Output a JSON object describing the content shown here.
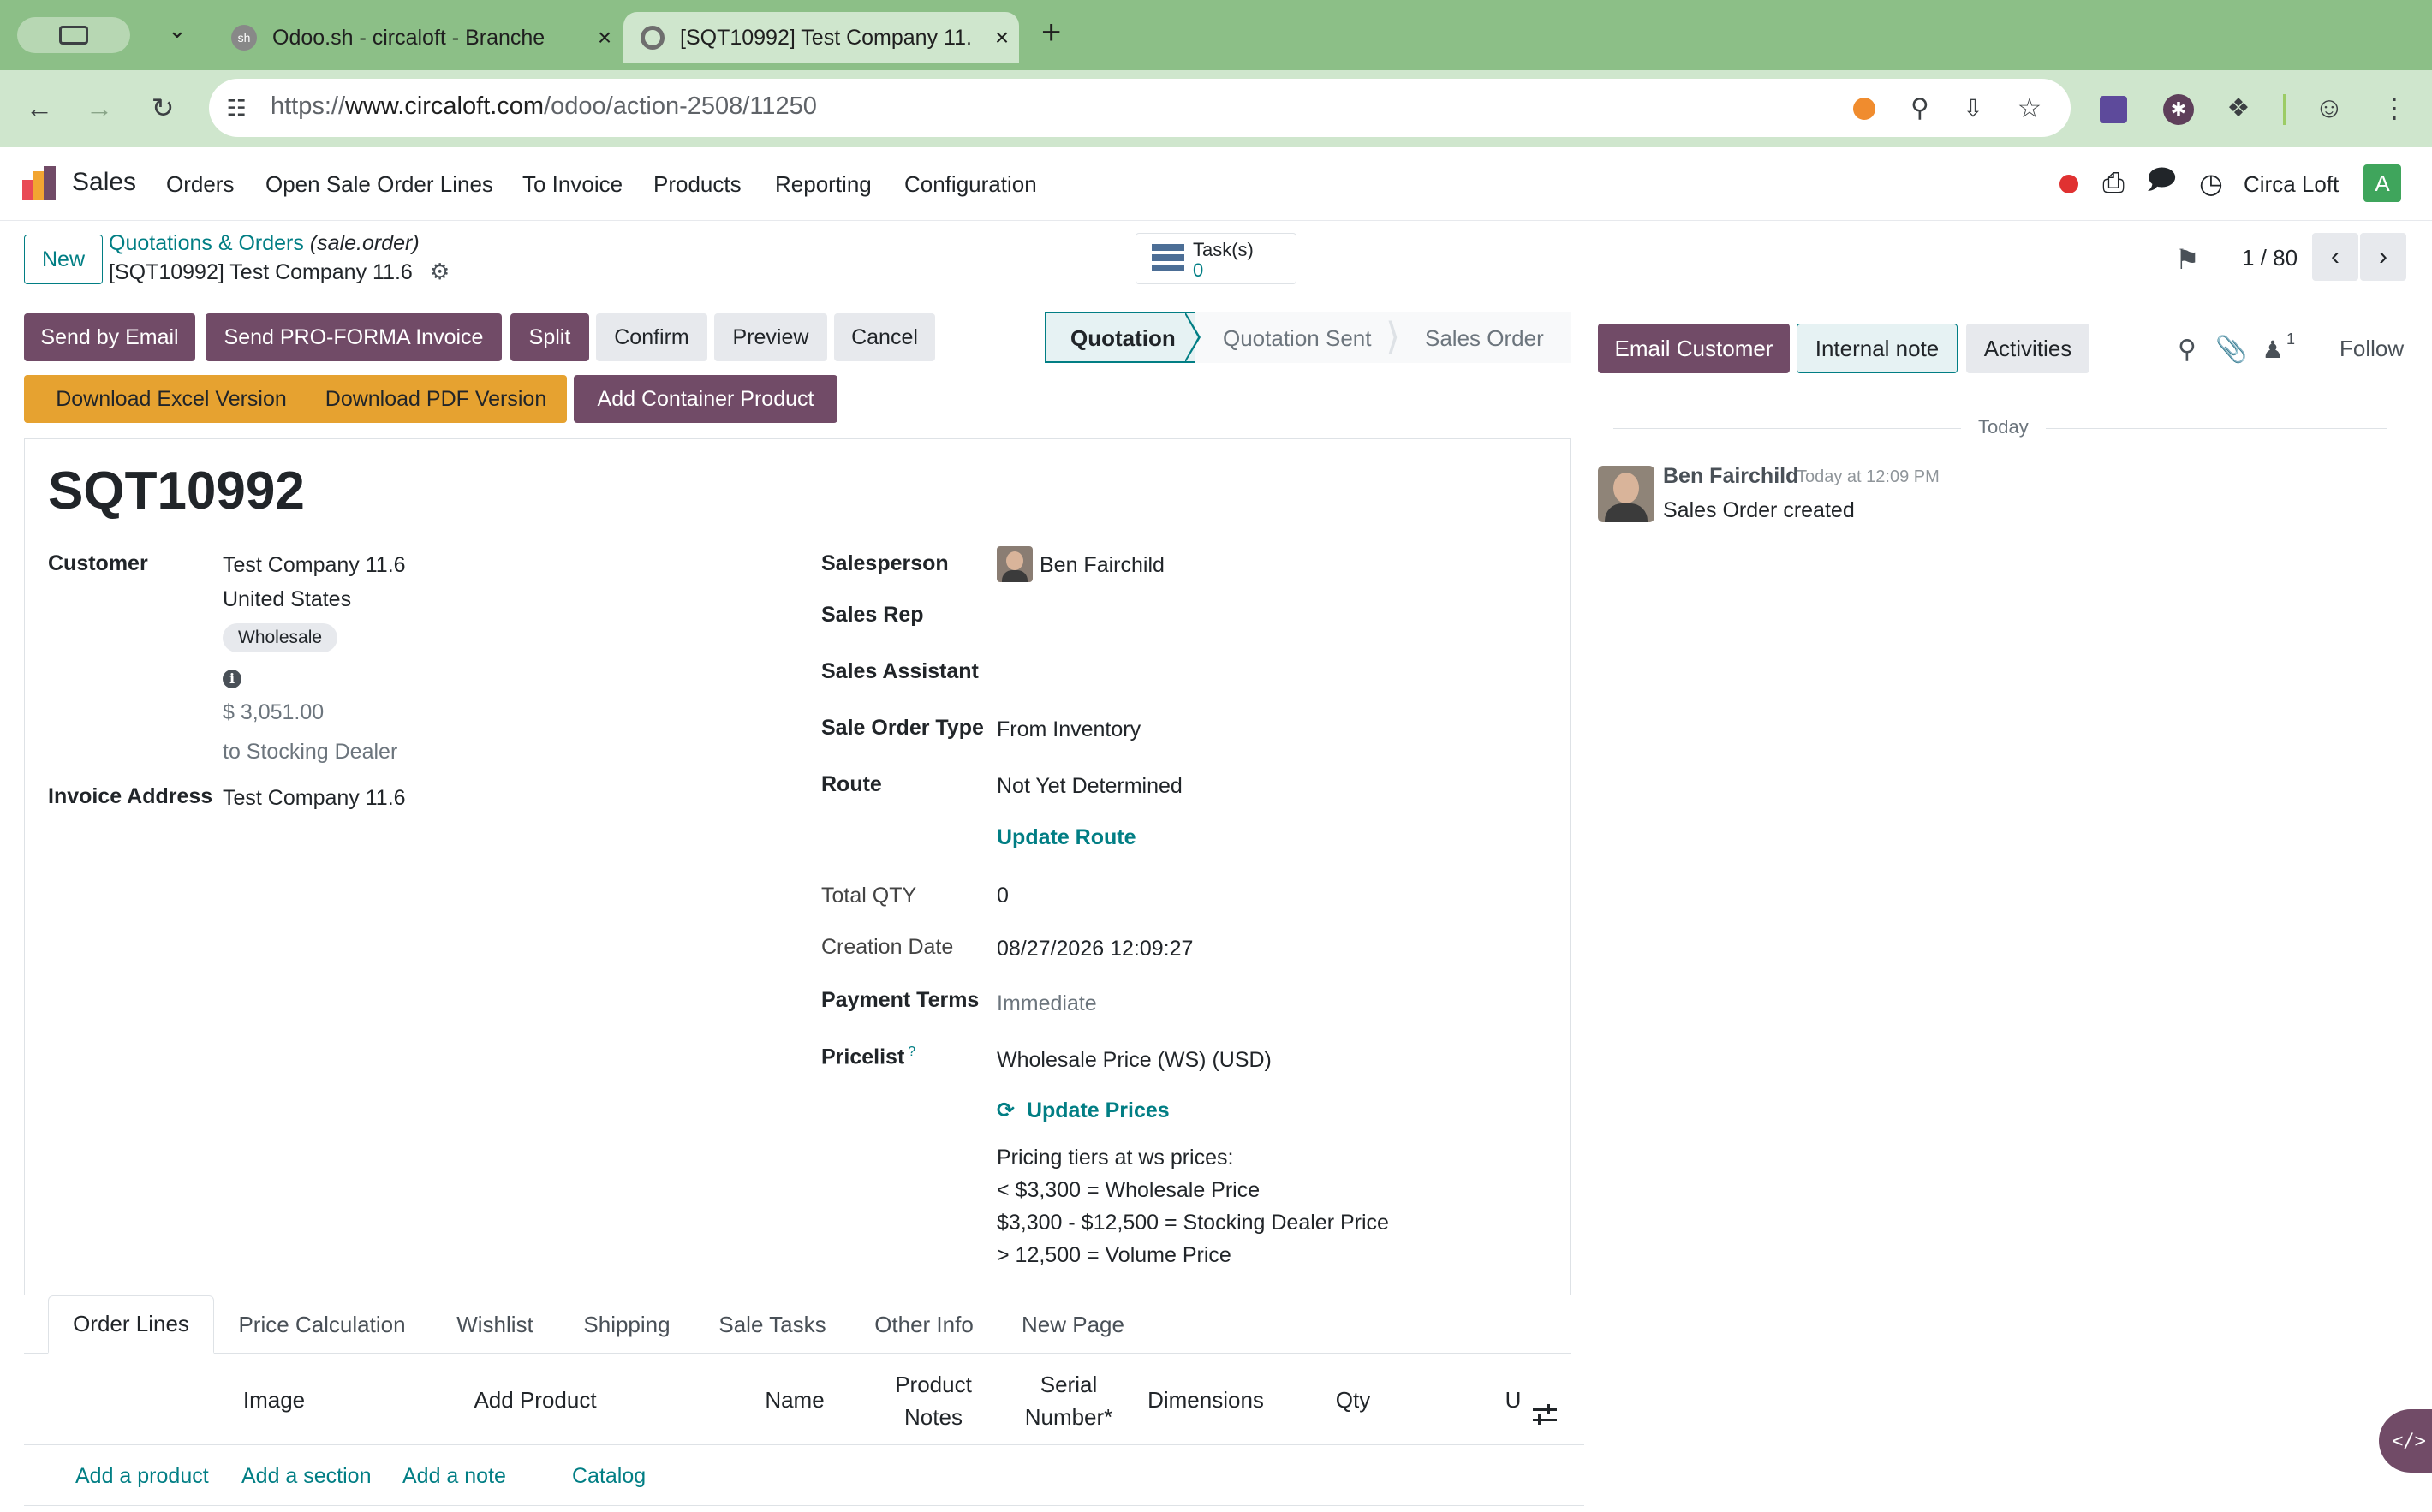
{
  "browser": {
    "tabs": [
      {
        "title": "Odoo.sh - circaloft - Branche",
        "active": false
      },
      {
        "title": "[SQT10992] Test Company 11.",
        "active": true
      }
    ],
    "favicon_text": "sh",
    "new_tab_symbol": "+",
    "url_prefix": "https://",
    "url_host": "www.circaloft.com",
    "url_path": "/odoo/action-2508/11250"
  },
  "app": {
    "name": "Sales",
    "menu": [
      "Orders",
      "Open Sale Order Lines",
      "To Invoice",
      "Products",
      "Reporting",
      "Configuration"
    ],
    "company": "Circa Loft",
    "user_initial": "A"
  },
  "control_panel": {
    "new_label": "New",
    "breadcrumb_parent": "Quotations & Orders",
    "breadcrumb_model": "(sale.order)",
    "record_name": "[SQT10992] Test Company 11.6",
    "tasks_label": "Task(s)",
    "tasks_count": "0",
    "pager": "1 / 80"
  },
  "actions": {
    "row1": [
      "Send by Email",
      "Send PRO-FORMA Invoice",
      "Split",
      "Confirm",
      "Preview",
      "Cancel"
    ],
    "row2": [
      "Download Excel Version",
      "Download PDF Version",
      "Add Container Product"
    ]
  },
  "statusbar": {
    "stages": [
      "Quotation",
      "Quotation Sent",
      "Sales Order"
    ],
    "current": "Quotation"
  },
  "form": {
    "title": "SQT10992",
    "customer_label": "Customer",
    "customer_name": "Test Company 11.6",
    "customer_country": "United States",
    "customer_tag": "Wholesale",
    "info_icon": "i",
    "amount": "$ 3,051.00",
    "amount_note": "to Stocking Dealer",
    "invoice_address_label": "Invoice Address",
    "invoice_address": "Test Company 11.6",
    "salesperson_label": "Salesperson",
    "salesperson": "Ben Fairchild",
    "sales_rep_label": "Sales Rep",
    "sales_assistant_label": "Sales Assistant",
    "sale_order_type_label": "Sale Order Type",
    "sale_order_type": "From Inventory",
    "route_label": "Route",
    "route": "Not Yet Determined",
    "update_route": "Update Route",
    "total_qty_label": "Total QTY",
    "total_qty": "0",
    "creation_date_label": "Creation Date",
    "creation_date": "08/27/2026 12:09:27",
    "payment_terms_label": "Payment Terms",
    "payment_terms": "Immediate",
    "pricelist_label": "Pricelist",
    "pricelist_help": "?",
    "pricelist": "Wholesale Price (WS) (USD)",
    "update_prices": "Update Prices",
    "pricing_tiers": [
      "Pricing tiers at ws prices:",
      "< $3,300 = Wholesale Price",
      "$3,300 - $12,500 = Stocking Dealer Price",
      "> 12,500 = Volume Price"
    ]
  },
  "notebook": {
    "tabs": [
      "Order Lines",
      "Price Calculation",
      "Wishlist",
      "Shipping",
      "Sale Tasks",
      "Other Info",
      "New Page"
    ],
    "columns": [
      "Image",
      "Add Product",
      "Name",
      "Product\nNotes",
      "Serial\nNumber*",
      "Dimensions",
      "Qty",
      "U"
    ],
    "add_links": [
      "Add a product",
      "Add a section",
      "Add a note",
      "Catalog"
    ]
  },
  "chatter": {
    "email_customer": "Email Customer",
    "internal_note": "Internal note",
    "activities": "Activities",
    "followers_count": "1",
    "follow": "Follow",
    "date_separator": "Today",
    "message_author": "Ben Fairchild",
    "message_time": "Today at 12:09 PM",
    "message_body": "Sales Order created"
  },
  "colors": {
    "primary": "#714b67",
    "accent": "#017e84",
    "warning": "#e6a230",
    "browser_frame": "#8cbf87"
  }
}
